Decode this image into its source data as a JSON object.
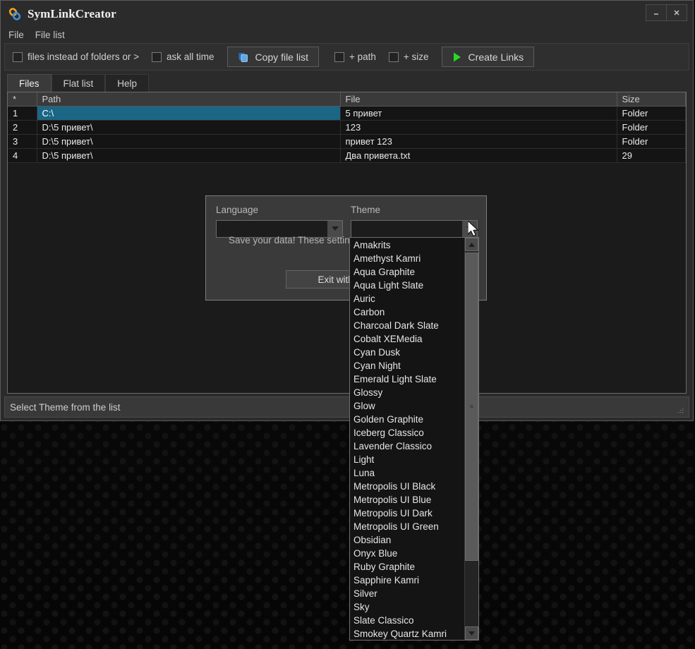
{
  "window": {
    "title": "SymLinkCreator",
    "icon": "chain-link-icon",
    "minimize_label": "_",
    "close_label": "×"
  },
  "menubar": {
    "items": [
      {
        "label": "File"
      },
      {
        "label": "File list"
      }
    ]
  },
  "toolbar": {
    "checkbox_files_instead": "files instead of folders or >",
    "checkbox_ask_all_time": "ask all time",
    "copy_file_list_label": "Copy file list",
    "copy_icon": "copy-icon",
    "checkbox_path": "+ path",
    "checkbox_size": "+ size",
    "create_links_label": "Create Links",
    "create_links_icon": "play-triangle-icon",
    "create_links_color": "#22dd22"
  },
  "tabs": [
    {
      "label": "Files",
      "active": true
    },
    {
      "label": "Flat list",
      "active": false
    },
    {
      "label": "Help",
      "active": false
    }
  ],
  "filetable": {
    "columns": [
      "*",
      "Path",
      "File",
      "Size"
    ],
    "rows": [
      {
        "index": "1",
        "path": "C:\\",
        "file": "5 привет",
        "size": "Folder",
        "selected": true
      },
      {
        "index": "2",
        "path": "D:\\5 привет\\",
        "file": "123",
        "size": "Folder",
        "selected": false
      },
      {
        "index": "3",
        "path": "D:\\5 привет\\",
        "file": "привет 123",
        "size": "Folder",
        "selected": false
      },
      {
        "index": "4",
        "path": "D:\\5 привет\\",
        "file": "Два привета.txt",
        "size": "29",
        "selected": false
      }
    ],
    "selection_color": "#1b6684"
  },
  "statusbar": {
    "text": "Select Theme from the list"
  },
  "dialog": {
    "language_label": "Language",
    "theme_label": "Theme",
    "language_value": "",
    "theme_value": "",
    "note": "Save your data! These settings",
    "exit_button": "Exit without"
  },
  "theme_dropdown": {
    "scroll_up_icon": "triangle-up-icon",
    "scroll_down_icon": "triangle-down-icon",
    "items": [
      "Amakrits",
      "Amethyst Kamri",
      "Aqua Graphite",
      "Aqua Light Slate",
      "Auric",
      "Carbon",
      "Charcoal Dark Slate",
      "Cobalt XEMedia",
      "Cyan Dusk",
      "Cyan Night",
      "Emerald Light Slate",
      "Glossy",
      "Glow",
      "Golden Graphite",
      "Iceberg Classico",
      "Lavender Classico",
      "Light",
      "Luna",
      "Metropolis UI Black",
      "Metropolis UI Blue",
      "Metropolis UI Dark",
      "Metropolis UI Green",
      "Obsidian",
      "Onyx Blue",
      "Ruby Graphite",
      "Sapphire Kamri",
      "Silver",
      "Sky",
      "Slate Classico",
      "Smokey Quartz Kamri"
    ]
  },
  "cursor": {
    "icon": "mouse-pointer-icon"
  }
}
